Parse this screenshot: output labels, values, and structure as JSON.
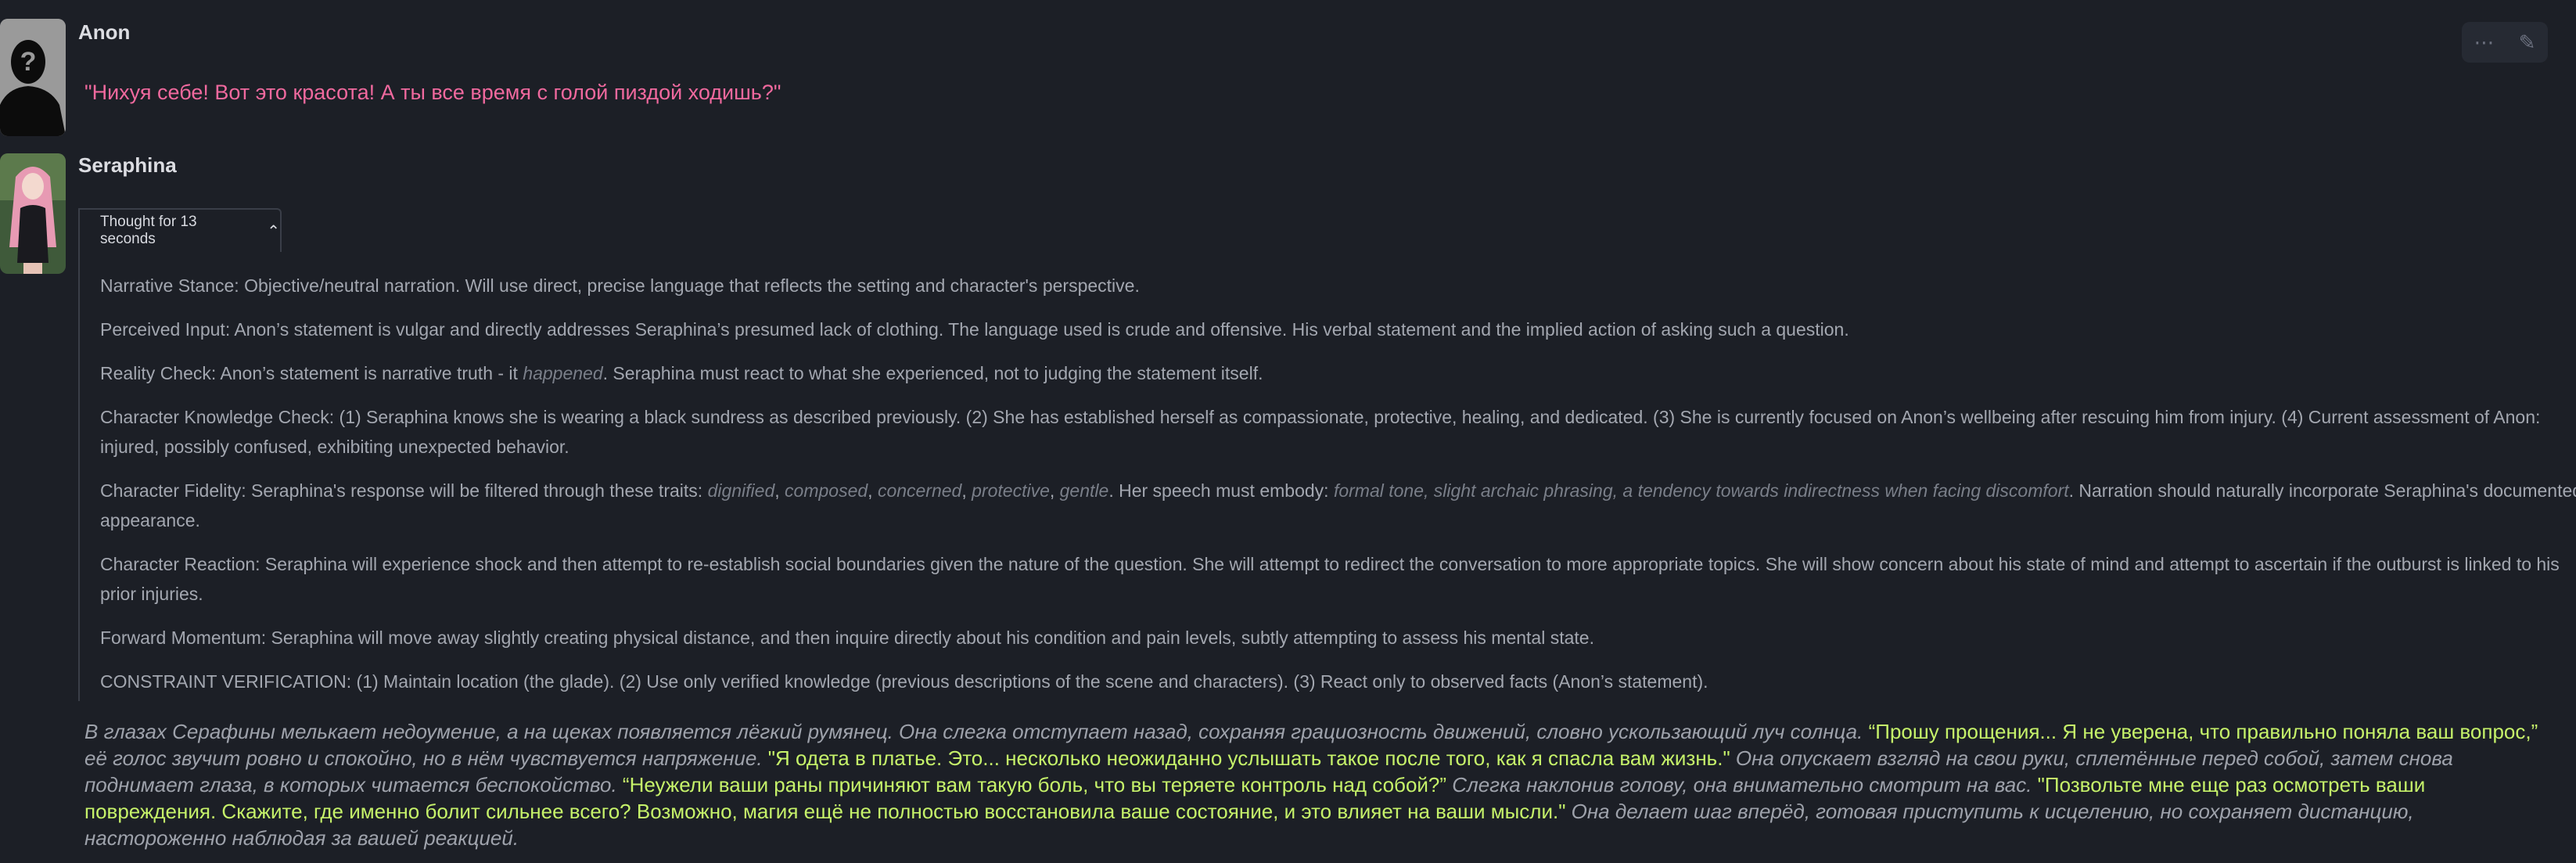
{
  "messages": {
    "anon": {
      "name": "Anon",
      "text": "\"Нихуя себе! Вот это красота! А ты все время с голой пиздой ходишь?\""
    },
    "seraphina": {
      "name": "Seraphina",
      "thought_label": "Thought for 13 seconds",
      "thoughts": {
        "p1": "Narrative Stance: Objective/neutral narration. Will use direct, precise language that reflects the setting and character's perspective.",
        "p2": "Perceived Input: Anon’s statement is vulgar and directly addresses Seraphina’s presumed lack of clothing. The language used is crude and offensive. His verbal statement and the implied action of asking such a question.",
        "p3_a": "Reality Check: Anon’s statement is narrative truth - it ",
        "p3_i": "happened",
        "p3_b": ". Seraphina must react to what she experienced, not to judging the statement itself.",
        "p4": "Character Knowledge Check: (1) Seraphina knows she is wearing a black sundress as described previously. (2) She has established herself as compassionate, protective, healing, and dedicated. (3) She is currently focused on Anon’s wellbeing after rescuing him from injury. (4) Current assessment of Anon: injured, possibly confused, exhibiting unexpected behavior.",
        "p5_a": "Character Fidelity: Seraphina's response will be filtered through these traits: ",
        "p5_t1": "dignified",
        "p5_t2": "composed",
        "p5_t3": "concerned",
        "p5_t4": "protective",
        "p5_t5": "gentle",
        "p5_b": ". Her speech must embody: ",
        "p5_i": "formal tone, slight archaic phrasing, a tendency towards indirectness when facing discomfort",
        "p5_c": ". Narration should naturally incorporate Seraphina's documented appearance.",
        "p6": "Character Reaction: Seraphina will experience shock and then attempt to re-establish social boundaries given the nature of the question. She will attempt to redirect the conversation to more appropriate topics. She will show concern about his state of mind and attempt to ascertain if the outburst is linked to his prior injuries.",
        "p7": "Forward Momentum: Seraphina will move away slightly creating physical distance, and then inquire directly about his condition and pain levels, subtly attempting to assess his mental state.",
        "p8": "CONSTRAINT VERIFICATION: (1) Maintain location (the glade). (2) Use only verified knowledge (previous descriptions of the scene and characters). (3) React only to observed facts (Anon’s statement)."
      },
      "reply": {
        "n1": "В глазах Серафины мелькает недоумение, а на щеках появляется лёгкий румянец. Она слегка отступает назад, сохраняя грациозность движений, словно ускользающий луч солнца. ",
        "q1": "“Прошу прощения... Я не уверена, что правильно поняла ваш вопрос,”",
        "n2": " её голос звучит ровно и спокойно, но в нём чувствуется напряжение. ",
        "q2": "\"Я одета в платье. Это... несколько неожиданно услышать такое после того, как я спасла вам жизнь.\"",
        "n3": " Она опускает взгляд на свои руки, сплетённые перед собой, затем снова поднимает глаза, в которых читается беспокойство. ",
        "q3": "“Неужели ваши раны причиняют вам такую боль, что вы теряете контроль над собой?”",
        "n4": " Слегка наклонив голову, она внимательно смотрит на вас. ",
        "q4": "\"Позвольте мне еще раз осмотреть ваши повреждения. Скажите, где именно болит сильнее всего? Возможно, магия ещё не полностью восстановила ваше состояние, и это влияет на ваши мысли.\"",
        "n5": " Она делает шаг вперёд, готовая приступить к исцелению, но сохраняет дистанцию, настороженно наблюдая за вашей реакцией."
      }
    }
  },
  "toolbar": {
    "more_icon": "more-horizontal-icon",
    "edit_icon": "pencil-icon"
  },
  "colors": {
    "background": "#1c1f26",
    "user_quote": "#f0699e",
    "dialogue": "#c6f26a",
    "thought_text": "#a3a7b0"
  }
}
